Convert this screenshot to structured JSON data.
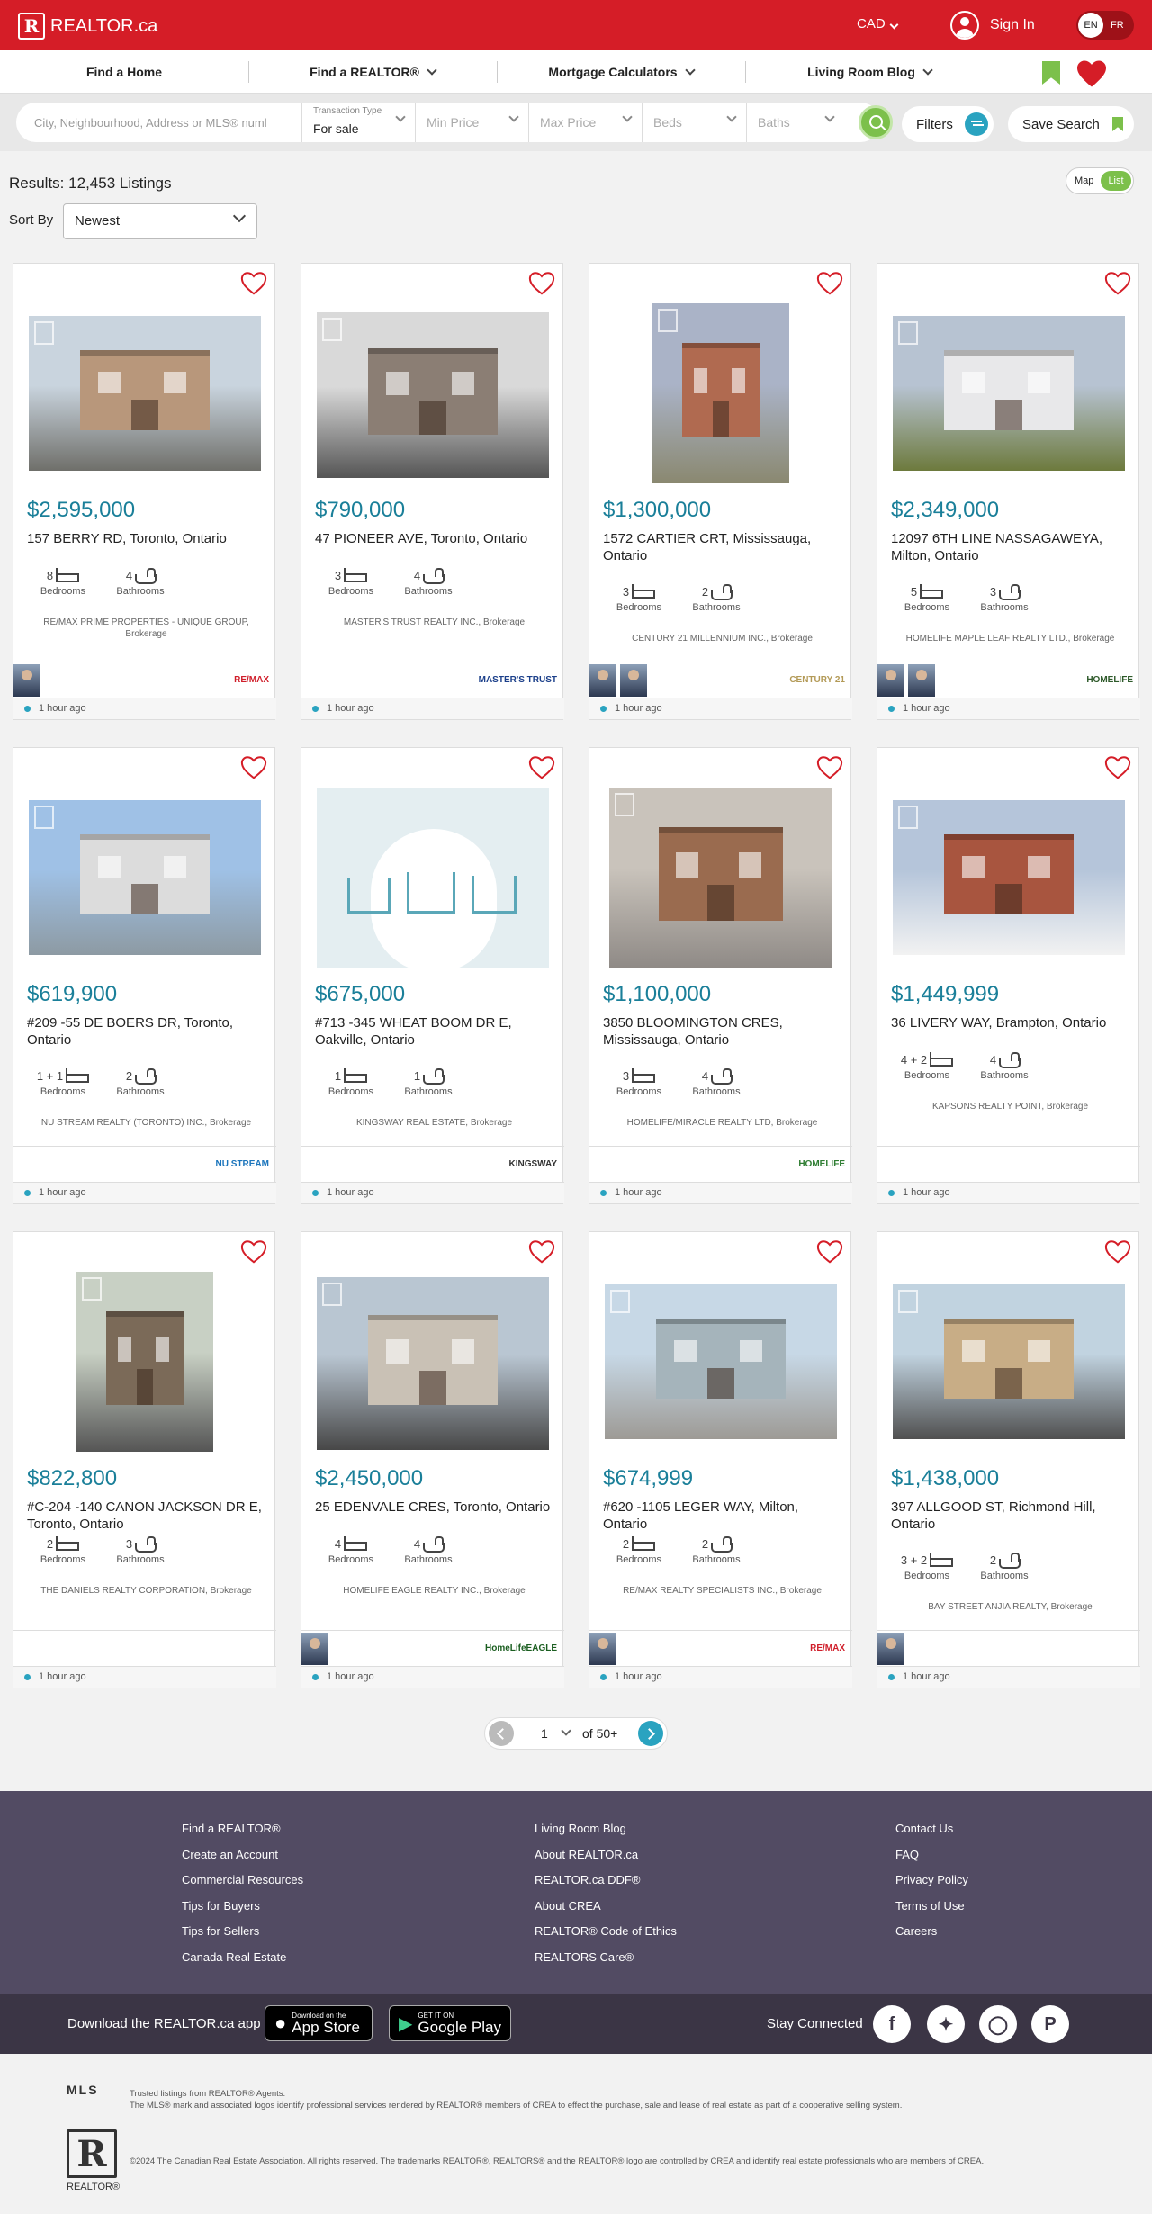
{
  "header": {
    "brand": "REALTOR.ca",
    "currency": "CAD",
    "signin": "Sign In",
    "lang_en": "EN",
    "lang_fr": "FR"
  },
  "nav": {
    "items": [
      "Find a Home",
      "Find a REALTOR®",
      "Mortgage Calculators",
      "Living Room Blog"
    ]
  },
  "search": {
    "location_placeholder": "City, Neighbourhood, Address or MLS® numl",
    "transaction_label": "Transaction Type",
    "transaction_value": "For sale",
    "min_price": "Min Price",
    "max_price": "Max Price",
    "beds": "Beds",
    "baths": "Baths",
    "filters": "Filters",
    "save_search": "Save Search"
  },
  "results": {
    "label": "Results:",
    "count": "12,453 Listings",
    "map": "Map",
    "list": "List",
    "sort_label": "Sort By",
    "sort_value": "Newest"
  },
  "labels": {
    "bedrooms": "Bedrooms",
    "bathrooms": "Bathrooms"
  },
  "listings": [
    {
      "price": "$2,595,000",
      "address": "157 BERRY RD, Toronto, Ontario",
      "beds": "8",
      "baths": "4",
      "broker": "RE/MAX PRIME PROPERTIES - UNIQUE GROUP, Brokerage",
      "logo": "RE/MAX",
      "time": "1 hour ago"
    },
    {
      "price": "$790,000",
      "address": "47 PIONEER AVE, Toronto, Ontario",
      "beds": "3",
      "baths": "4",
      "broker": "MASTER'S TRUST REALTY INC., Brokerage",
      "logo": "MASTER'S TRUST",
      "time": "1 hour ago"
    },
    {
      "price": "$1,300,000",
      "address": "1572 CARTIER CRT, Mississauga, Ontario",
      "beds": "3",
      "baths": "2",
      "broker": "CENTURY 21 MILLENNIUM INC., Brokerage",
      "logo": "CENTURY 21",
      "time": "1 hour ago"
    },
    {
      "price": "$2,349,000",
      "address": "12097 6TH LINE NASSAGAWEYA, Milton, Ontario",
      "beds": "5",
      "baths": "3",
      "broker": "HOMELIFE MAPLE LEAF REALTY LTD., Brokerage",
      "logo": "HOMELIFE",
      "time": "1 hour ago"
    },
    {
      "price": "$619,900",
      "address": "#209 -55 DE BOERS DR, Toronto, Ontario",
      "beds": "1 + 1",
      "baths": "2",
      "broker": "NU STREAM REALTY (TORONTO) INC., Brokerage",
      "logo": "NU STREAM",
      "time": "1 hour ago"
    },
    {
      "price": "$675,000",
      "address": "#713 -345 WHEAT BOOM DR E, Oakville, Ontario",
      "beds": "1",
      "baths": "1",
      "broker": "KINGSWAY REAL ESTATE, Brokerage",
      "logo": "KINGSWAY",
      "time": "1 hour ago"
    },
    {
      "price": "$1,100,000",
      "address": "3850 BLOOMINGTON CRES, Mississauga, Ontario",
      "beds": "3",
      "baths": "4",
      "broker": "HOMELIFE/MIRACLE REALTY LTD, Brokerage",
      "logo": "HOMELIFE",
      "time": "1 hour ago"
    },
    {
      "price": "$1,449,999",
      "address": "36 LIVERY WAY, Brampton, Ontario",
      "beds": "4 + 2",
      "baths": "4",
      "broker": "KAPSONS REALTY POINT, Brokerage",
      "logo": "",
      "time": "1 hour ago"
    },
    {
      "price": "$822,800",
      "address": "#C-204 -140 CANON JACKSON DR E, Toronto, Ontario",
      "beds": "2",
      "baths": "3",
      "broker": "THE DANIELS REALTY CORPORATION, Brokerage",
      "logo": "",
      "time": "1 hour ago"
    },
    {
      "price": "$2,450,000",
      "address": "25 EDENVALE CRES, Toronto, Ontario",
      "beds": "4",
      "baths": "4",
      "broker": "HOMELIFE EAGLE REALTY INC., Brokerage",
      "logo": "HomeLifeEAGLE",
      "time": "1 hour ago"
    },
    {
      "price": "$674,999",
      "address": "#620 -1105 LEGER WAY, Milton, Ontario",
      "beds": "2",
      "baths": "2",
      "broker": "RE/MAX REALTY SPECIALISTS INC., Brokerage",
      "logo": "RE/MAX",
      "time": "1 hour ago"
    },
    {
      "price": "$1,438,000",
      "address": "397 ALLGOOD ST, Richmond Hill, Ontario",
      "beds": "3 + 2",
      "baths": "2",
      "broker": "BAY STREET ANJIA REALTY, Brokerage",
      "logo": "",
      "time": "1 hour ago"
    }
  ],
  "pagination": {
    "current": "1",
    "of": "of 50+"
  },
  "footer": {
    "col1": [
      "Find a REALTOR®",
      "Create an Account",
      "Commercial Resources",
      "Tips for Buyers",
      "Tips for Sellers",
      "Canada Real Estate"
    ],
    "col2": [
      "Living Room Blog",
      "About REALTOR.ca",
      "REALTOR.ca DDF®",
      "About CREA",
      "REALTOR® Code of Ethics",
      "REALTORS Care®"
    ],
    "col3": [
      "Contact Us",
      "FAQ",
      "Privacy Policy",
      "Terms of Use",
      "Careers"
    ],
    "download": "Download the REALTOR.ca app",
    "appstore_small": "Download on the",
    "appstore": "App Store",
    "googleplay_small": "GET IT ON",
    "googleplay": "Google Play",
    "stay_connected": "Stay Connected",
    "mls_text1": "Trusted listings from REALTOR® Agents.",
    "mls_text2": "The MLS® mark and associated logos identify professional services rendered by REALTOR® members of CREA to effect the purchase, sale and lease of real estate as part of a cooperative selling system.",
    "copyright": "©2024 The Canadian Real Estate Association. All rights reserved. The trademarks REALTOR®, REALTORS® and the REALTOR® logo are controlled by CREA and identify real estate professionals who are members of CREA.",
    "realtor_logo": "REALTOR®",
    "mls_logo": "MLS"
  },
  "colors": {
    "brand_red": "#d51d27",
    "price_teal": "#1a7f99",
    "accent_green": "#7cc04b"
  }
}
